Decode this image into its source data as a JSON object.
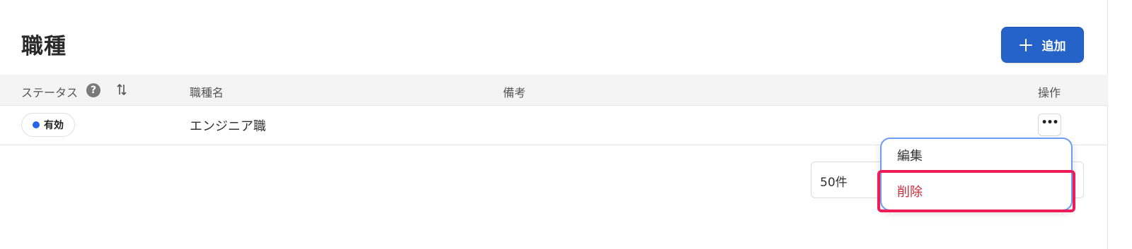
{
  "page": {
    "title": "職種"
  },
  "toolbar": {
    "add_label": "追加",
    "add_icon": "plus-icon"
  },
  "table": {
    "columns": {
      "status": "ステータス",
      "status_help": "?",
      "name": "職種名",
      "notes": "備考",
      "actions": "操作"
    },
    "rows": [
      {
        "status": "有効",
        "status_color": "#2563eb",
        "name": "エンジニア職",
        "notes": ""
      }
    ]
  },
  "pagination": {
    "page_size": "50件"
  },
  "row_menu": {
    "items": [
      {
        "label": "編集"
      },
      {
        "label": "削除",
        "color": "#d4283b"
      }
    ]
  },
  "colors": {
    "accent": "#2563c9",
    "highlight": "#ee1b57"
  }
}
